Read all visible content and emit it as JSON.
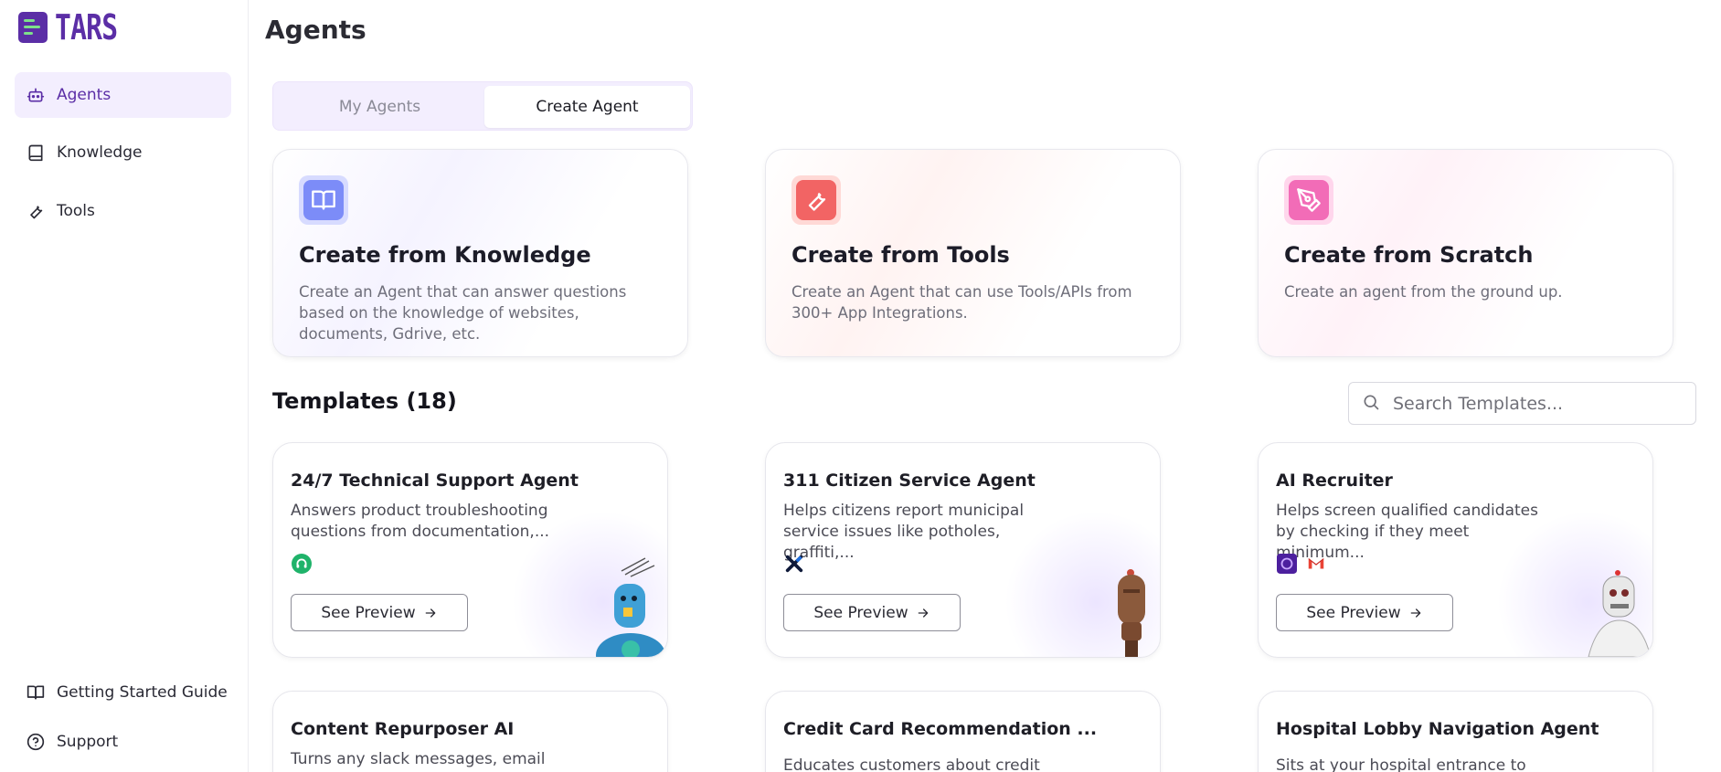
{
  "app": {
    "name": "TARS"
  },
  "sidebar": {
    "items": [
      {
        "label": "Agents",
        "icon": "robot-icon",
        "active": true
      },
      {
        "label": "Knowledge",
        "icon": "book-icon",
        "active": false
      },
      {
        "label": "Tools",
        "icon": "wrench-icon",
        "active": false
      }
    ],
    "footer": [
      {
        "label": "Getting Started Guide",
        "icon": "open-book-icon"
      },
      {
        "label": "Support",
        "icon": "help-circle-icon"
      }
    ]
  },
  "page": {
    "title": "Agents"
  },
  "tabs": [
    {
      "label": "My Agents",
      "selected": false
    },
    {
      "label": "Create Agent",
      "selected": true
    }
  ],
  "create_cards": [
    {
      "title": "Create from Knowledge",
      "description": "Create an Agent that can answer questions based on the knowledge of websites, documents, Gdrive, etc.",
      "icon": "book-icon",
      "color": "#7c8cf8"
    },
    {
      "title": "Create from Tools",
      "description": "Create an Agent that can use Tools/APIs from 300+ App Integrations.",
      "icon": "wrench-icon",
      "color": "#f26464"
    },
    {
      "title": "Create from Scratch",
      "description": "Create an agent from the ground up.",
      "icon": "pen-tool-icon",
      "color": "#f26cb7"
    }
  ],
  "templates": {
    "heading": "Templates (18)",
    "search_placeholder": "Search Templates...",
    "preview_label": "See Preview",
    "items": [
      {
        "title": "24/7 Technical Support Agent",
        "description": "Answers product troubleshooting questions from documentation,...",
        "integrations": [
          "headset-icon"
        ]
      },
      {
        "title": "311 Citizen Service Agent",
        "description": "Helps citizens report municipal service issues like potholes, graffiti,...",
        "integrations": [
          "x-logo-icon"
        ]
      },
      {
        "title": "AI Recruiter",
        "description": "Helps screen qualified candidates by checking if they meet minimum...",
        "integrations": [
          "brain-app-icon",
          "gmail-icon"
        ]
      },
      {
        "title": "Content Repurposer AI",
        "description": "Turns any slack messages, email"
      },
      {
        "title": "Credit Card Recommendation ...",
        "description": "Educates customers about credit"
      },
      {
        "title": "Hospital Lobby Navigation Agent",
        "description": "Sits at your hospital entrance to help"
      }
    ]
  },
  "colors": {
    "brand": "#5b2ea6",
    "accent_bg": "#f3eefe"
  }
}
